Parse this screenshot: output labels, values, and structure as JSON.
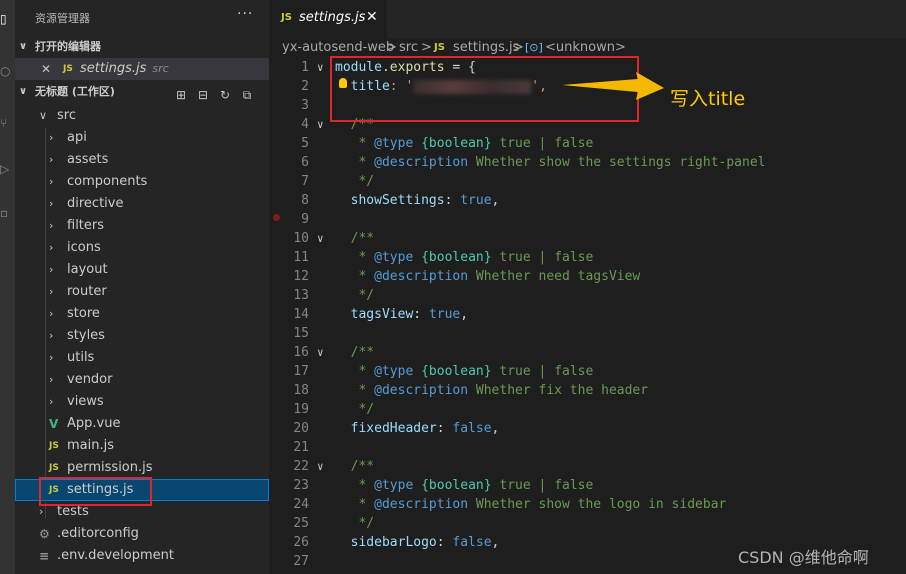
{
  "explorer": {
    "title": "资源管理器",
    "more": "···",
    "open_editors_label": "打开的编辑器",
    "open_editor": {
      "close": "✕",
      "icon": "JS",
      "name": "settings.js",
      "folder": "src"
    },
    "workspace_label": "无标题 (工作区)",
    "tree": [
      {
        "label": "src",
        "type": "folder-open"
      },
      {
        "label": "api",
        "type": "folder"
      },
      {
        "label": "assets",
        "type": "folder"
      },
      {
        "label": "components",
        "type": "folder"
      },
      {
        "label": "directive",
        "type": "folder"
      },
      {
        "label": "filters",
        "type": "folder"
      },
      {
        "label": "icons",
        "type": "folder"
      },
      {
        "label": "layout",
        "type": "folder"
      },
      {
        "label": "router",
        "type": "folder"
      },
      {
        "label": "store",
        "type": "folder"
      },
      {
        "label": "styles",
        "type": "folder"
      },
      {
        "label": "utils",
        "type": "folder"
      },
      {
        "label": "vendor",
        "type": "folder"
      },
      {
        "label": "views",
        "type": "folder"
      },
      {
        "label": "App.vue",
        "type": "vue",
        "icon": "V"
      },
      {
        "label": "main.js",
        "type": "js",
        "icon": "JS"
      },
      {
        "label": "permission.js",
        "type": "js",
        "icon": "JS"
      },
      {
        "label": "settings.js",
        "type": "js",
        "icon": "JS",
        "selected": true
      },
      {
        "label": "tests",
        "type": "folder"
      },
      {
        "label": ".editorconfig",
        "type": "gear",
        "icon": "⚙"
      },
      {
        "label": ".env.development",
        "type": "lines",
        "icon": "≡"
      }
    ]
  },
  "tab": {
    "icon": "JS",
    "name": "settings.js",
    "close": "✕"
  },
  "breadcrumb": {
    "project": "yx-autosend-web",
    "folder": "src",
    "file_icon": "JS",
    "file": "settings.js",
    "symbol_icon": "[⊙]",
    "symbol": "<unknown>",
    "sep": ">"
  },
  "code_lines": [
    {
      "n": "1",
      "fold": true
    },
    {
      "n": "2"
    },
    {
      "n": "3"
    },
    {
      "n": "4",
      "fold": true
    },
    {
      "n": "5"
    },
    {
      "n": "6"
    },
    {
      "n": "7"
    },
    {
      "n": "8"
    },
    {
      "n": "9"
    },
    {
      "n": "10",
      "fold": true
    },
    {
      "n": "11"
    },
    {
      "n": "12"
    },
    {
      "n": "13"
    },
    {
      "n": "14"
    },
    {
      "n": "15"
    },
    {
      "n": "16",
      "fold": true
    },
    {
      "n": "17"
    },
    {
      "n": "18"
    },
    {
      "n": "19"
    },
    {
      "n": "20"
    },
    {
      "n": "21"
    },
    {
      "n": "22",
      "fold": true
    },
    {
      "n": "23"
    },
    {
      "n": "24"
    },
    {
      "n": "25"
    },
    {
      "n": "26"
    },
    {
      "n": "27"
    }
  ],
  "code": {
    "l1a": "module",
    "l1b": ".",
    "l1c": "exports",
    "l1d": " = {",
    "l2_key": "title",
    "l2_colon": ": '",
    "l2_end": "',",
    "c_open": "/**",
    "c_star": " * ",
    "c_type_tag": "@type",
    "c_type": "{boolean}",
    "c_true": "true",
    "c_pipe": " | ",
    "c_false": "false",
    "c_desc_tag": "@description",
    "d1": " Whether show the settings right-panel",
    "d2": " Whether need tagsView",
    "d3": " Whether fix the header",
    "d4": " Whether show the logo in sidebar",
    "c_close": " */",
    "k1": "showSettings",
    "v1": "true",
    "k2": "tagsView",
    "v2": "true",
    "k3": "fixedHeader",
    "v3": "false",
    "k4": "sidebarLogo",
    "v4": "false",
    "colon": ": ",
    "comma": ","
  },
  "annotation": {
    "text": "写入title",
    "arrow_color": "#f5b800",
    "box_color": "#e0262c"
  },
  "watermark": "CSDN @维他命啊",
  "colors": {
    "accent": "#007fd4",
    "js_icon": "#cbcb41",
    "vue_icon": "#41b883"
  }
}
